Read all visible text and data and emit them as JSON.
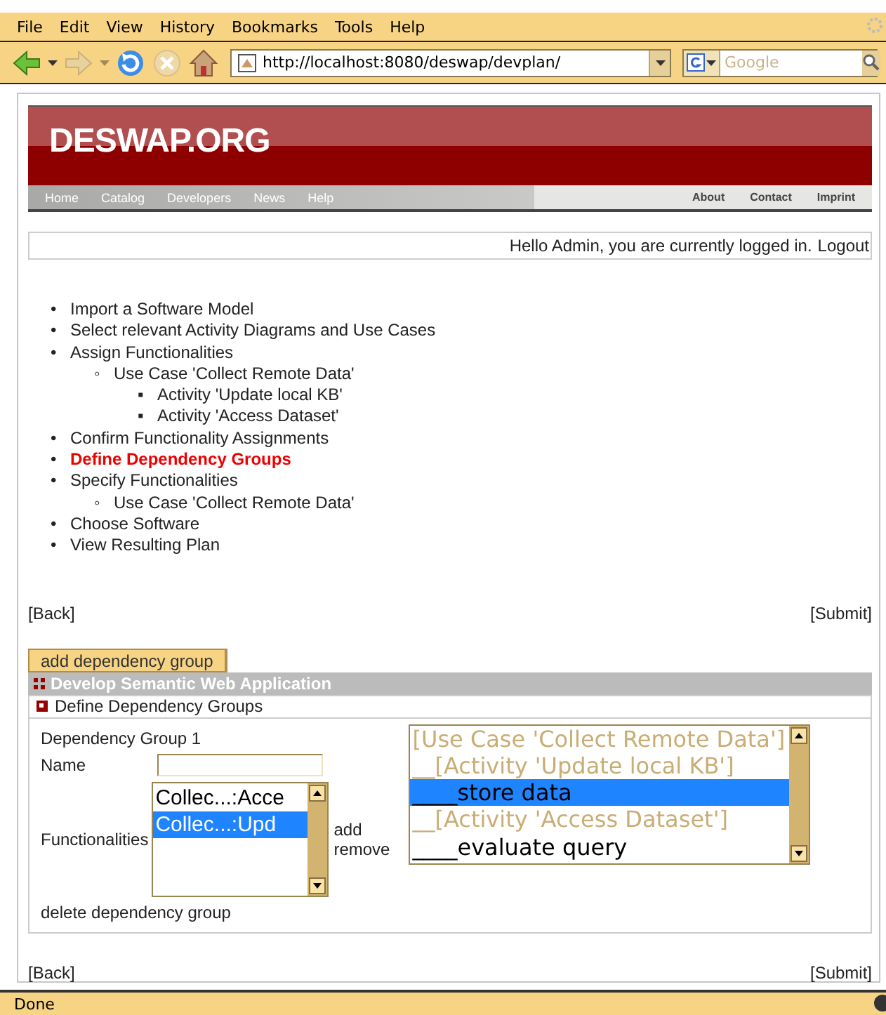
{
  "menu": [
    "File",
    "Edit",
    "View",
    "History",
    "Bookmarks",
    "Tools",
    "Help"
  ],
  "toolbar": {
    "url": "http://localhost:8080/deswap/devplan/",
    "search_placeholder": "Google"
  },
  "header": {
    "logo": "DESWAP.ORG",
    "nav_left": [
      "Home",
      "Catalog",
      "Developers",
      "News",
      "Help"
    ],
    "nav_right": [
      "About",
      "Contact",
      "Imprint"
    ]
  },
  "login": {
    "text": "Hello Admin, you are currently logged in.",
    "link": "Logout"
  },
  "steps": [
    {
      "marker": "•",
      "label": "Import a Software Model",
      "current": false
    },
    {
      "marker": "•",
      "label": "Select relevant Activity Diagrams and Use Cases",
      "current": false
    },
    {
      "marker": "•",
      "label": "Assign Functionalities",
      "current": false,
      "children": [
        {
          "marker": "◦",
          "label": "Use Case 'Collect Remote Data'",
          "current": false,
          "children": [
            {
              "marker": "▪",
              "label": "Activity 'Update local KB'",
              "current": false
            },
            {
              "marker": "▪",
              "label": "Activity 'Access Dataset'",
              "current": false
            }
          ]
        }
      ]
    },
    {
      "marker": "•",
      "label": "Confirm Functionality Assignments",
      "current": false
    },
    {
      "marker": "•",
      "label": "Define Dependency Groups",
      "current": true
    },
    {
      "marker": "•",
      "label": "Specify Functionalities",
      "current": false,
      "children": [
        {
          "marker": "◦",
          "label": "Use Case 'Collect Remote Data'",
          "current": false
        }
      ]
    },
    {
      "marker": "•",
      "label": "Choose Software",
      "current": false
    },
    {
      "marker": "•",
      "label": "View Resulting Plan",
      "current": false
    }
  ],
  "nav_top": {
    "back": "[Back]",
    "submit": "[Submit]"
  },
  "add_button": "add dependency group",
  "panel": {
    "title": "Develop Semantic Web Application",
    "subtitle": "Define Dependency Groups"
  },
  "group": {
    "heading": "Dependency Group 1",
    "name_label": "Name",
    "functionalities_label": "Functionalities",
    "functionalities": [
      {
        "label": "Collec...:Acce",
        "selected": false
      },
      {
        "label": "Collec...:Upd",
        "selected": true
      }
    ],
    "add": "add",
    "remove": "remove",
    "tree": [
      {
        "label": "[Use Case 'Collect Remote Data']",
        "kind": "group",
        "selected": false
      },
      {
        "label": "__[Activity 'Update local KB']",
        "kind": "group",
        "selected": false
      },
      {
        "label": "____store data",
        "kind": "option",
        "selected": true
      },
      {
        "label": "__[Activity 'Access Dataset']",
        "kind": "group",
        "selected": false
      },
      {
        "label": "____evaluate query",
        "kind": "option",
        "selected": false
      }
    ],
    "delete": "delete dependency group"
  },
  "nav_bottom": {
    "back": "[Back]",
    "submit": "[Submit]"
  },
  "status": "Done"
}
